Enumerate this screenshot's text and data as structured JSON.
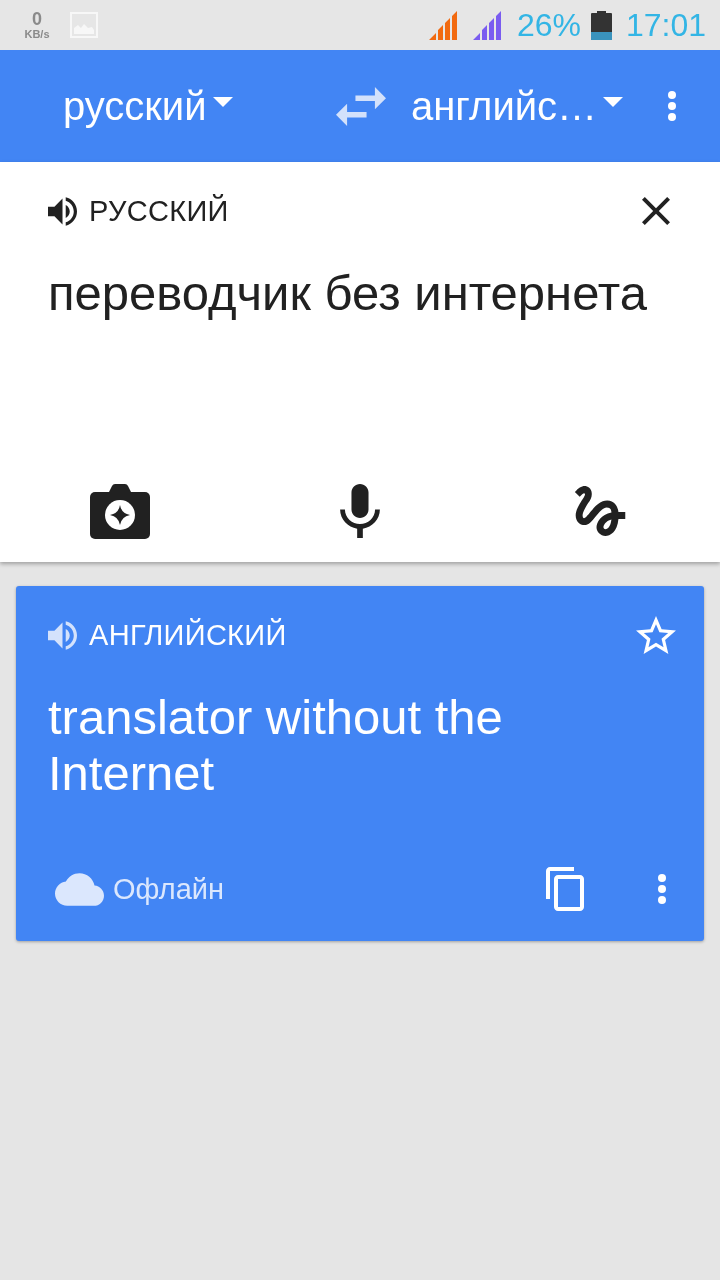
{
  "status_bar": {
    "network_speed": "0",
    "network_speed_unit": "KB/s",
    "battery": "26%",
    "time": "17:01"
  },
  "toolbar": {
    "source_language": "русский",
    "target_language": "английс…"
  },
  "input_card": {
    "language_label": "РУССКИЙ",
    "text": "переводчик без интернета"
  },
  "result_card": {
    "language_label": "АНГЛИЙСКИЙ",
    "starred": false,
    "text": "translator without the Internet",
    "status": "Офлайн"
  }
}
